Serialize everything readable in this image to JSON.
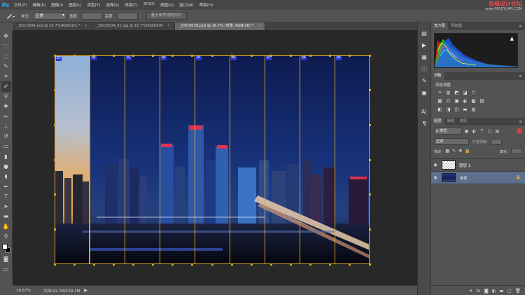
{
  "app": {
    "logo": "Ps",
    "menu": [
      "文件(F)",
      "编辑(E)",
      "图像(I)",
      "图层(L)",
      "类型(Y)",
      "选择(S)",
      "滤镜(T)",
      "3D(D)",
      "视图(V)",
      "窗口(W)",
      "帮助(H)"
    ],
    "watermark_title": "思缘设计论坛",
    "watermark_url": "www.MISSYUAN.COM"
  },
  "options": {
    "tool_icon": "slice-select-icon",
    "style_label": "样式:",
    "style_value": "正常",
    "width_label": "宽度:",
    "height_label": "高度:",
    "slices_button": "基于参考线的切片"
  },
  "tabs": [
    {
      "label": "_DSC0004.psd @ 16.7%(RGB/16) *",
      "active": false
    },
    {
      "label": "_DSC0004_01.jpg @ 16.7%(RGB/8#)",
      "active": false
    },
    {
      "label": "_DSC0038.psd @ 16.7% (背景, RGB/16) *",
      "active": true
    }
  ],
  "close_glyph": "×",
  "slices": [
    "01",
    "02",
    "03",
    "04",
    "05",
    "06",
    "07",
    "08",
    "09"
  ],
  "status": {
    "zoom": "16.67%",
    "docinfo": "文档:91.7M/109.3M",
    "arrow": "▶"
  },
  "panels": {
    "histogram_tabs": [
      "直方图",
      "导航器"
    ],
    "histogram_warning": "▲",
    "adjust_tab": "调整",
    "adjust_title": "添加调整",
    "adjust_row1": [
      "☼",
      "▥",
      "◩",
      "◪",
      "▽"
    ],
    "adjust_row2": [
      "▦",
      "⚖",
      "▣",
      "◐",
      "▩",
      "▤"
    ],
    "adjust_row3": [
      "◧",
      "◨",
      "◫",
      "▬",
      "▧"
    ],
    "layers_tabs": [
      "图层",
      "通道",
      "路径"
    ],
    "filter_value": "ρ 类型",
    "blend_value": "正常",
    "opacity_label": "不透明度:",
    "lock_label": "锁定:",
    "fill_label": "填充:",
    "layers": [
      {
        "name": "图层 1",
        "selected": false,
        "thumb": "transparent"
      },
      {
        "name": "背景",
        "selected": true,
        "thumb": "photo"
      }
    ]
  },
  "colors": {
    "slice_line": "#d9a42e",
    "slice_label_bg": "#2d3ad6",
    "selected_layer": "#5d6f8c",
    "ps_blue": "#31a8ff",
    "watermark_red": "#e8484d"
  }
}
